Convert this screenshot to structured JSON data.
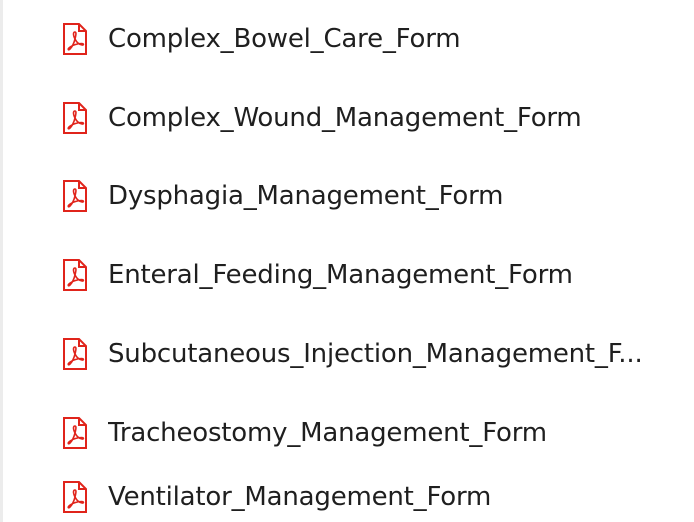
{
  "files": [
    {
      "icon": "pdf-file-icon",
      "name": "Complex_Bowel_Care_Form"
    },
    {
      "icon": "pdf-file-icon",
      "name": "Complex_Wound_Management_Form"
    },
    {
      "icon": "pdf-file-icon",
      "name": "Dysphagia_Management_Form"
    },
    {
      "icon": "pdf-file-icon",
      "name": "Enteral_Feeding_Management_Form"
    },
    {
      "icon": "pdf-file-icon",
      "name": "Subcutaneous_Injection_Management_F..."
    },
    {
      "icon": "pdf-file-icon",
      "name": "Tracheostomy_Management_Form"
    },
    {
      "icon": "pdf-file-icon",
      "name": "Ventilator_Management_Form"
    }
  ],
  "colors": {
    "pdf_red": "#e0241b",
    "text": "#1f1f1f",
    "background": "#ffffff"
  }
}
